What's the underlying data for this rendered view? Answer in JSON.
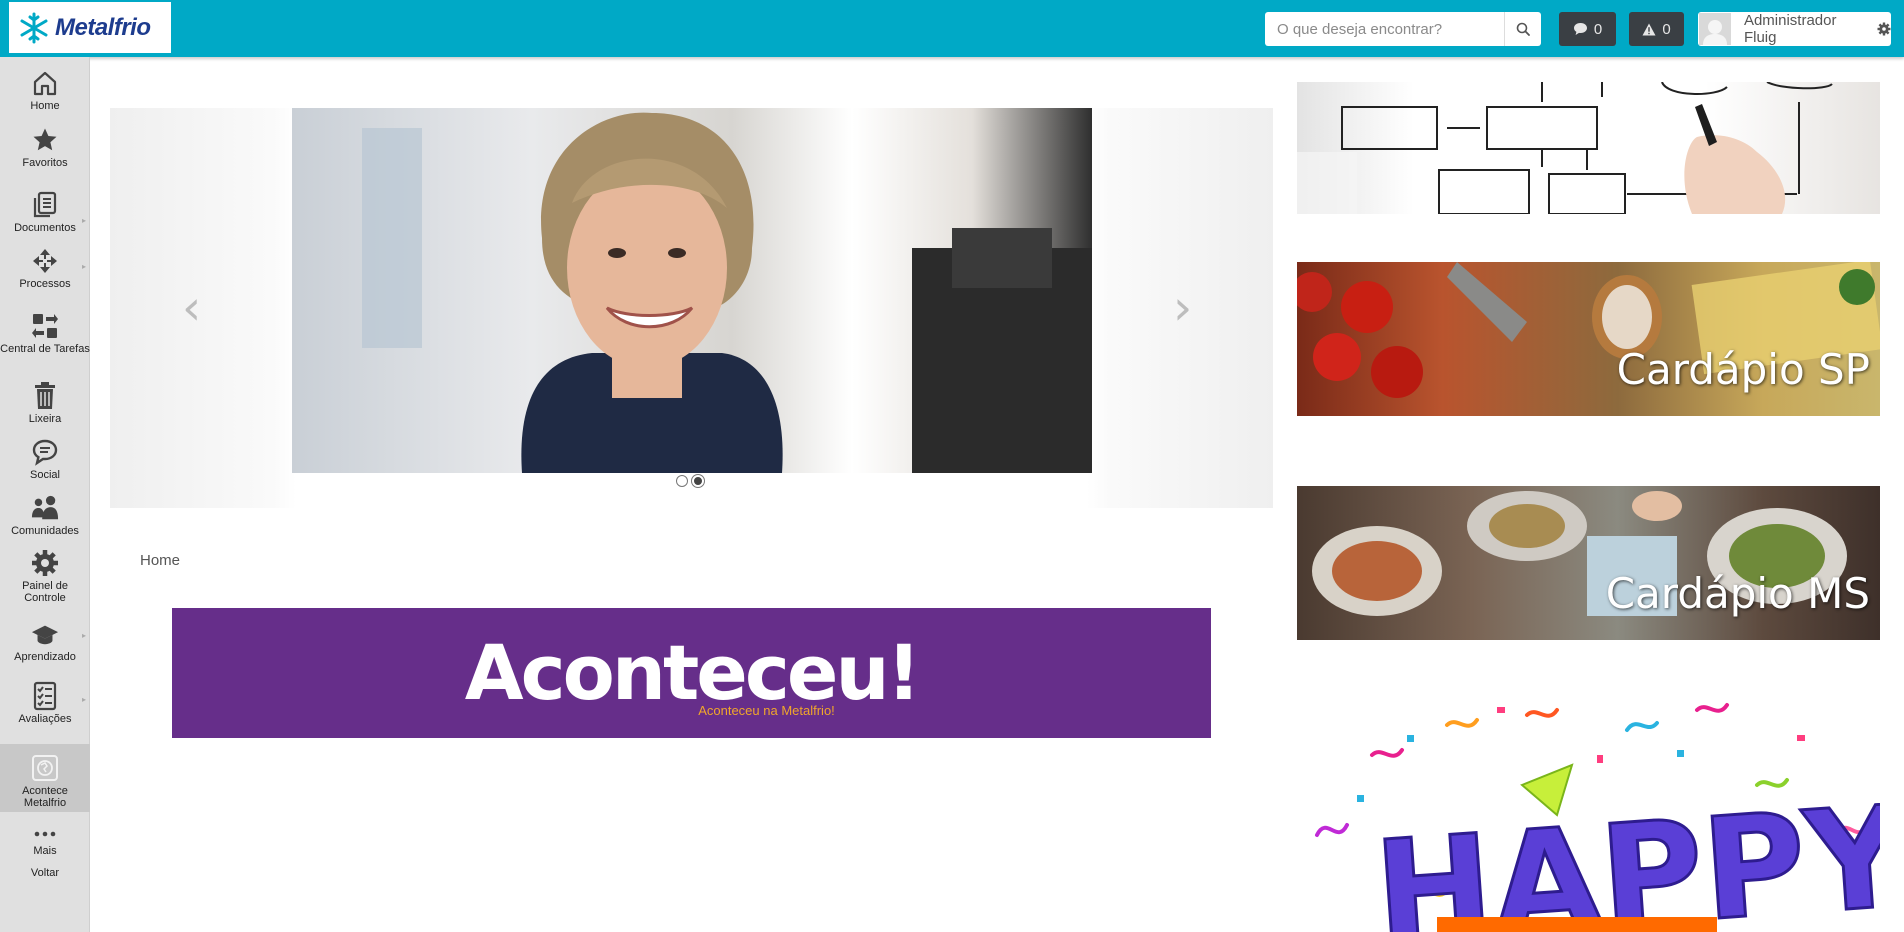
{
  "header": {
    "logo_text": "Metalfrio",
    "search_placeholder": "O que deseja encontrar?",
    "messages_count": "0",
    "alerts_count": "0",
    "user_name": "Administrador Fluig"
  },
  "sidebar": {
    "items": [
      {
        "label": "Home",
        "icon": "home-icon"
      },
      {
        "label": "Favoritos",
        "icon": "star-icon"
      },
      {
        "label": "Documentos",
        "icon": "documents-icon"
      },
      {
        "label": "Processos",
        "icon": "processes-icon"
      },
      {
        "label": "Central de Tarefas",
        "icon": "tasks-icon"
      },
      {
        "label": "Lixeira",
        "icon": "trash-icon"
      },
      {
        "label": "Social",
        "icon": "chat-icon"
      },
      {
        "label": "Comunidades",
        "icon": "communities-icon"
      },
      {
        "label": "Painel de Controle",
        "icon": "gear-icon"
      },
      {
        "label": "Aprendizado",
        "icon": "graduation-cap-icon"
      },
      {
        "label": "Avaliações",
        "icon": "checklist-icon"
      },
      {
        "label": "Acontece Metalfrio",
        "icon": "globe-icon"
      },
      {
        "label": "Mais",
        "icon": "more-icon"
      },
      {
        "label": "Voltar",
        "icon": ""
      }
    ]
  },
  "carousel": {
    "prev_glyph": "‹",
    "next_glyph": "›",
    "active_index": 1,
    "slide_count": 2
  },
  "breadcrumb": "Home",
  "banner": {
    "title": "Aconteceu!",
    "subtitle": "Aconteceu na Metalfrio!"
  },
  "right_cards": {
    "cardapio_sp": "Cardápio SP",
    "cardapio_ms": "Cardápio MS",
    "birthday_text": "HAPPY"
  },
  "colors": {
    "topbar": "#00a9c6",
    "banner": "#662e8a",
    "banner_sub": "#f0a62b",
    "dark_button": "#3a3f44"
  }
}
